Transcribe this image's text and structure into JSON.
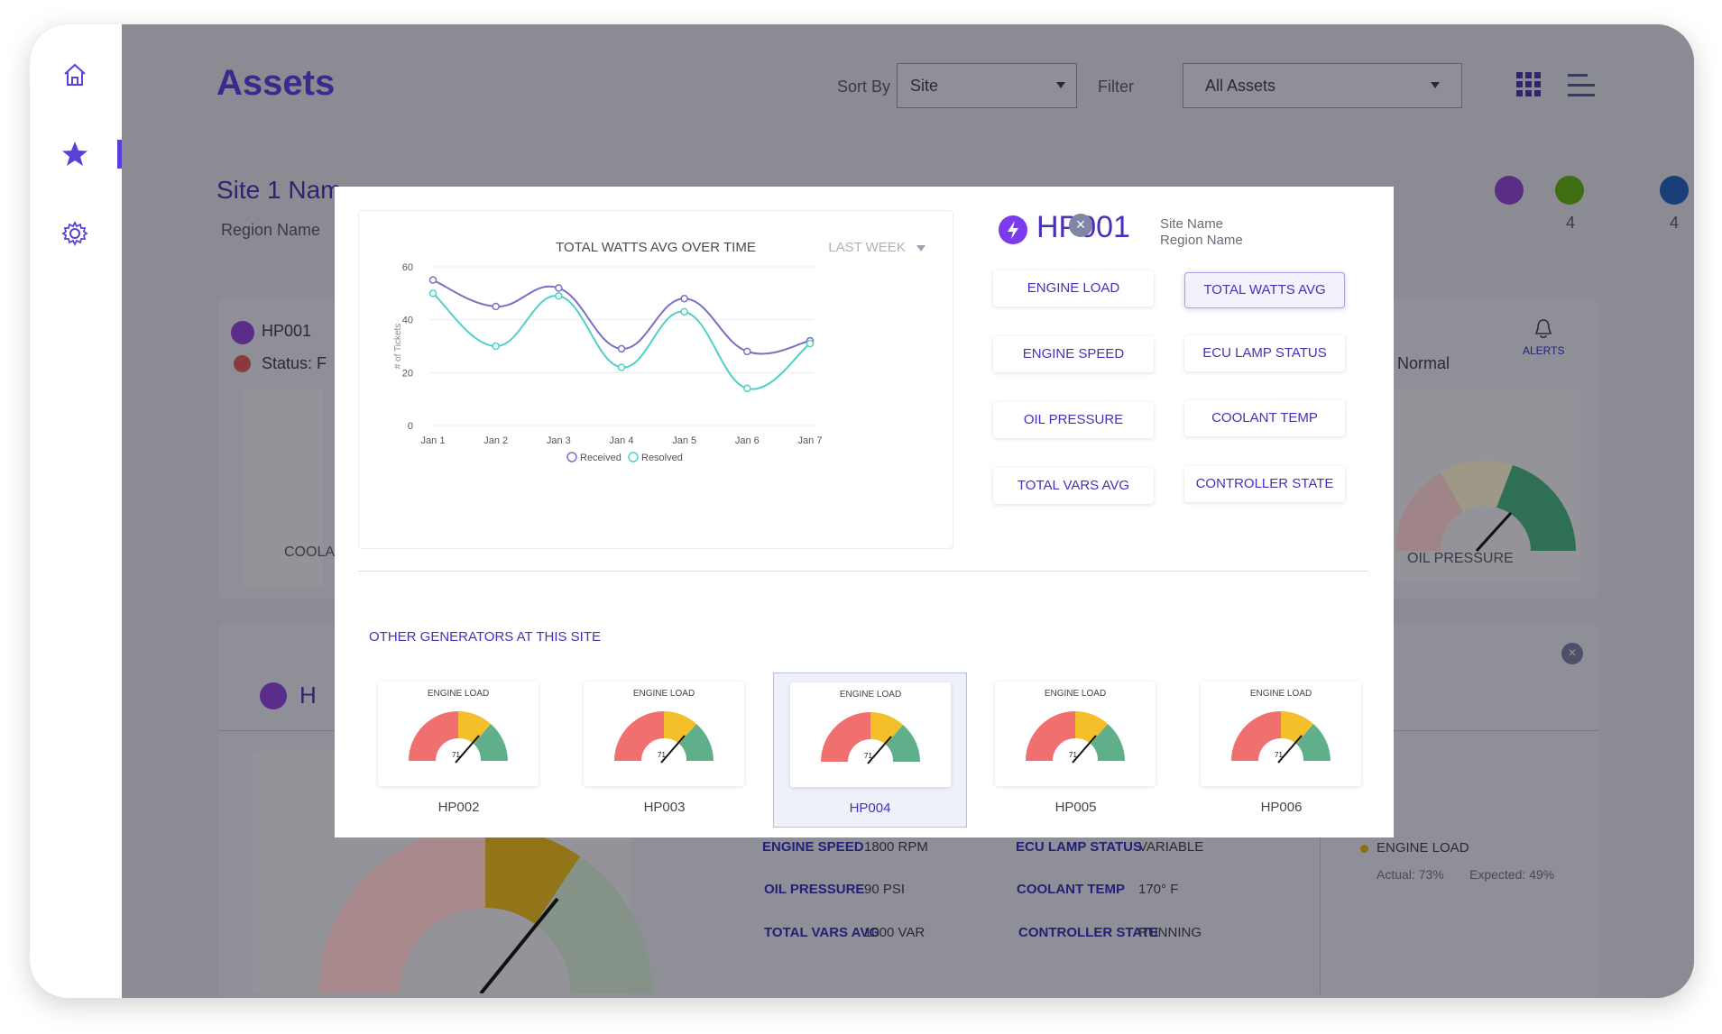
{
  "page": {
    "title": "Assets"
  },
  "controls": {
    "sort_label": "Sort By",
    "sort_value": "Site",
    "filter_label": "Filter",
    "filter_value": "All Assets"
  },
  "sidebar": {
    "items": [
      {
        "name": "home",
        "icon": "home-icon"
      },
      {
        "name": "favorites",
        "icon": "star-icon",
        "active": true
      },
      {
        "name": "settings",
        "icon": "gear-icon"
      }
    ]
  },
  "background": {
    "site_title": "Site 1 Nam",
    "region": "Region Name",
    "counts": [
      "4",
      "4"
    ],
    "card1": {
      "gen": "HP001",
      "status": "Status: F",
      "coola": "COOLA",
      "normal": "Normal",
      "alerts": "ALERTS",
      "oil_pressure": "OIL PRESSURE",
      "gauge_value": "71"
    },
    "card2": {
      "letter": "H",
      "engine_speed_label": "ENGINE SPEED",
      "engine_speed_value": "1800 RPM",
      "oil_pressure_label": "OIL PRESSURE",
      "oil_pressure_value": "90 PSI",
      "total_vars_label": "TOTAL VARS AVG",
      "total_vars_value": "1000 VAR",
      "ecu_lamp_label": "ECU LAMP STATUS",
      "ecu_lamp_value": "VARIABLE",
      "coolant_label": "COOLANT TEMP",
      "coolant_value": "170° F",
      "controller_label": "CONTROLLER STATE",
      "controller_value": "RUNNING",
      "alert_title": "ENGINE LOAD",
      "alert_actual": "Actual: 73%",
      "alert_expected": "Expected: 49%",
      "gauge_value": "71"
    }
  },
  "modal": {
    "generator": "HP001",
    "site_name": "Site Name",
    "region_name": "Region Name",
    "metric_buttons": [
      {
        "label": "ENGINE LOAD",
        "active": false
      },
      {
        "label": "TOTAL WATTS AVG",
        "active": true
      },
      {
        "label": "ENGINE SPEED",
        "active": false
      },
      {
        "label": "ECU LAMP STATUS",
        "active": false
      },
      {
        "label": "OIL PRESSURE",
        "active": false
      },
      {
        "label": "COOLANT TEMP",
        "active": false
      },
      {
        "label": "TOTAL VARS AVG",
        "active": false
      },
      {
        "label": "CONTROLLER STATE",
        "active": false
      }
    ],
    "range_label": "LAST WEEK",
    "other_title": "OTHER GENERATORS AT THIS SITE",
    "others": [
      {
        "name": "HP002",
        "gauge_title": "ENGINE LOAD",
        "gauge_value": "71",
        "selected": false
      },
      {
        "name": "HP003",
        "gauge_title": "ENGINE LOAD",
        "gauge_value": "71",
        "selected": false
      },
      {
        "name": "HP004",
        "gauge_title": "ENGINE LOAD",
        "gauge_value": "71",
        "selected": true
      },
      {
        "name": "HP005",
        "gauge_title": "ENGINE LOAD",
        "gauge_value": "71",
        "selected": false
      },
      {
        "name": "HP006",
        "gauge_title": "ENGINE LOAD",
        "gauge_value": "71",
        "selected": false
      }
    ]
  },
  "colors": {
    "accent": "#4b2fb8",
    "received": "#7b6fc4",
    "resolved": "#4fd1c5",
    "gauge_red": "#f07070",
    "gauge_yellow": "#f5bf2a",
    "gauge_green": "#5fb08a"
  },
  "chart_data": {
    "type": "line",
    "title": "TOTAL WATTS AVG OVER TIME",
    "ylabel": "# of Tickets",
    "xlabel": "",
    "categories": [
      "Jan 1",
      "Jan 2",
      "Jan 3",
      "Jan 4",
      "Jan 5",
      "Jan 6",
      "Jan 7"
    ],
    "ylim": [
      0,
      60
    ],
    "yticks": [
      0,
      20,
      40,
      60
    ],
    "series": [
      {
        "name": "Received",
        "values": [
          55,
          45,
          52,
          29,
          48,
          28,
          32
        ]
      },
      {
        "name": "Resolved",
        "values": [
          50,
          30,
          49,
          22,
          43,
          14,
          31
        ]
      }
    ],
    "legend": "bottom",
    "grid": true
  }
}
